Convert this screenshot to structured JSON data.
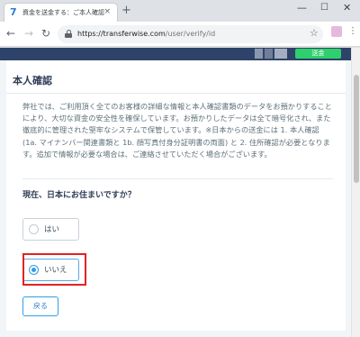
{
  "browser": {
    "tab": {
      "favicon": "7",
      "title": "資金を送金する：ご本人確認",
      "close": "×"
    },
    "new_tab": "+",
    "window_controls": {
      "minimize": "—",
      "maximize": "☐",
      "close": "✕"
    },
    "nav": {
      "back": "←",
      "forward": "→",
      "reload": "↻"
    },
    "url": {
      "host": "https://transferwise.com",
      "path": "/user/verify/id"
    },
    "bookmark_icon": "☆",
    "menu_icon": "⋮"
  },
  "site_header": {
    "send_button": "送金"
  },
  "main": {
    "title": "本人確認",
    "notice": "弊社では、ご利用頂く全てのお客様の詳細な情報と本人確認書類のデータをお預かりすることにより、大切な資金の安全性を確保しています。お預かりしたデータは全て暗号化され、また徹底的に管理された堅牢なシステムで保管しています。※日本からの送金には 1. 本人確認 (1a. マイナンバー関連書類と 1b. 顔写真付身分証明書の両面) と 2. 住所確認が必要となります。追加で情報が必要な場合は、ご連絡させていただく場合がございます。",
    "question": "現在、日本にお住まいですか？",
    "options": [
      {
        "label": "はい",
        "selected": false
      },
      {
        "label": "いいえ",
        "selected": true
      }
    ],
    "back_button": "戻る"
  },
  "colors": {
    "header_navy": "#2e4369",
    "send_green": "#2ed06e",
    "accent_blue": "#2e9fe6",
    "highlight_red": "#e32222"
  }
}
